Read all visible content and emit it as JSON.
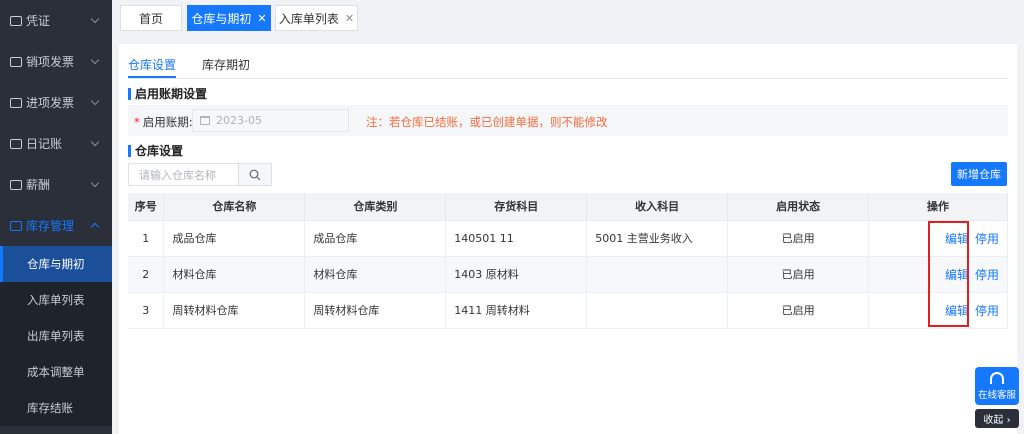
{
  "sidebar": {
    "menus": [
      {
        "label": "凭证",
        "icon": "voucher-icon"
      },
      {
        "label": "销项发票",
        "icon": "invoice-icon"
      },
      {
        "label": "进项发票",
        "icon": "invoice-in-icon"
      },
      {
        "label": "日记账",
        "icon": "journal-icon"
      },
      {
        "label": "薪酬",
        "icon": "salary-icon"
      },
      {
        "label": "库存管理",
        "icon": "warehouse-icon"
      }
    ],
    "submenu": [
      "仓库与期初",
      "入库单列表",
      "出库单列表",
      "成本调整单",
      "库存结账"
    ]
  },
  "tabs": {
    "home": "首页",
    "warehouse": "仓库与期初",
    "inbound": "入库单列表",
    "close_symbol": "✕"
  },
  "subtabs": {
    "settings": "仓库设置",
    "opening": "库存期初"
  },
  "period": {
    "section_title": "启用账期设置",
    "required_mark": "*",
    "label": "启用账期:",
    "value": "2023-05",
    "note": "注：若仓库已结账，或已创建单据，则不能修改"
  },
  "warehouse": {
    "section_title": "仓库设置",
    "search_placeholder": "请输入仓库名称",
    "add_button": "新增仓库",
    "columns": [
      "序号",
      "仓库名称",
      "仓库类别",
      "存货科目",
      "收入科目",
      "启用状态",
      "操作"
    ],
    "rows": [
      {
        "no": "1",
        "name": "成品仓库",
        "category": "成品仓库",
        "inventory_account": "140501 11",
        "income_account": "5001 主营业务收入",
        "status": "已启用",
        "edit": "编辑",
        "disable": "停用"
      },
      {
        "no": "2",
        "name": "材料仓库",
        "category": "材料仓库",
        "inventory_account": "1403 原材料",
        "income_account": "",
        "status": "已启用",
        "edit": "编辑",
        "disable": "停用"
      },
      {
        "no": "3",
        "name": "周转材料仓库",
        "category": "周转材料仓库",
        "inventory_account": "1411 周转材料",
        "income_account": "",
        "status": "已启用",
        "edit": "编辑",
        "disable": "停用"
      }
    ]
  },
  "widgets": {
    "service": "在线客服",
    "collapse": "收起 ›"
  },
  "colors": {
    "primary": "#1677ff",
    "sidebar": "#2b2f3a",
    "highlight": "#e02020",
    "note": "#f56c3c"
  }
}
